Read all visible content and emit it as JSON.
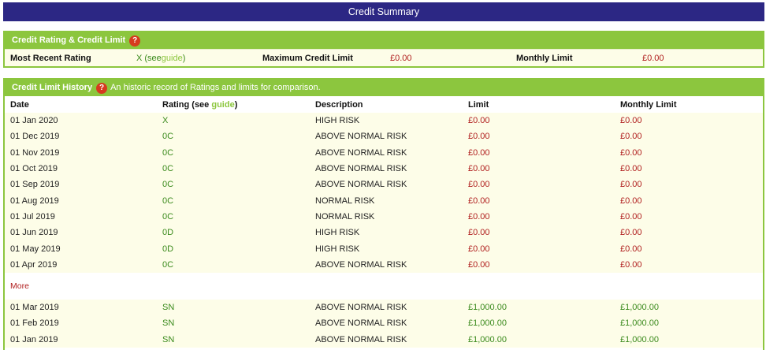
{
  "title": "Credit Summary",
  "panel1": {
    "heading": "Credit Rating & Credit Limit",
    "help_icon": "?",
    "most_recent_label": "Most Recent Rating",
    "rating_prefix": "X (see ",
    "rating_link": "guide",
    "rating_suffix": ")",
    "max_limit_label": "Maximum Credit Limit",
    "max_limit_value": "£0.00",
    "monthly_limit_label": "Monthly Limit",
    "monthly_limit_value": "£0.00"
  },
  "panel2": {
    "heading": "Credit Limit History",
    "help_icon": "?",
    "subheading": "An historic record of Ratings and limits for comparison.",
    "columns": {
      "date": "Date",
      "rating_prefix": "Rating (see ",
      "rating_link": "guide",
      "rating_suffix": ")",
      "description": "Description",
      "limit": "Limit",
      "monthly_limit": "Monthly Limit"
    },
    "rows": [
      {
        "date": "01 Jan 2020",
        "rating": "X",
        "description": "HIGH RISK",
        "limit": "£0.00",
        "monthly": "£0.00"
      },
      {
        "date": "01 Dec 2019",
        "rating": "0C",
        "description": "ABOVE NORMAL RISK",
        "limit": "£0.00",
        "monthly": "£0.00"
      },
      {
        "date": "01 Nov 2019",
        "rating": "0C",
        "description": "ABOVE NORMAL RISK",
        "limit": "£0.00",
        "monthly": "£0.00"
      },
      {
        "date": "01 Oct 2019",
        "rating": "0C",
        "description": "ABOVE NORMAL RISK",
        "limit": "£0.00",
        "monthly": "£0.00"
      },
      {
        "date": "01 Sep 2019",
        "rating": "0C",
        "description": "ABOVE NORMAL RISK",
        "limit": "£0.00",
        "monthly": "£0.00"
      },
      {
        "date": "01 Aug 2019",
        "rating": "0C",
        "description": "NORMAL RISK",
        "limit": "£0.00",
        "monthly": "£0.00"
      },
      {
        "date": "01 Jul 2019",
        "rating": "0C",
        "description": "NORMAL RISK",
        "limit": "£0.00",
        "monthly": "£0.00"
      },
      {
        "date": "01 Jun 2019",
        "rating": "0D",
        "description": "HIGH RISK",
        "limit": "£0.00",
        "monthly": "£0.00"
      },
      {
        "date": "01 May 2019",
        "rating": "0D",
        "description": "HIGH RISK",
        "limit": "£0.00",
        "monthly": "£0.00"
      },
      {
        "date": "01 Apr 2019",
        "rating": "0C",
        "description": "ABOVE NORMAL RISK",
        "limit": "£0.00",
        "monthly": "£0.00"
      }
    ],
    "more_label": "More",
    "older_rows": [
      {
        "date": "01 Mar 2019",
        "rating": "SN",
        "description": "ABOVE NORMAL RISK",
        "limit": "£1,000.00",
        "monthly": "£1,000.00"
      },
      {
        "date": "01 Feb 2019",
        "rating": "SN",
        "description": "ABOVE NORMAL RISK",
        "limit": "£1,000.00",
        "monthly": "£1,000.00"
      },
      {
        "date": "01 Jan 2019",
        "rating": "SN",
        "description": "ABOVE NORMAL RISK",
        "limit": "£1,000.00",
        "monthly": "£1,000.00"
      }
    ]
  }
}
